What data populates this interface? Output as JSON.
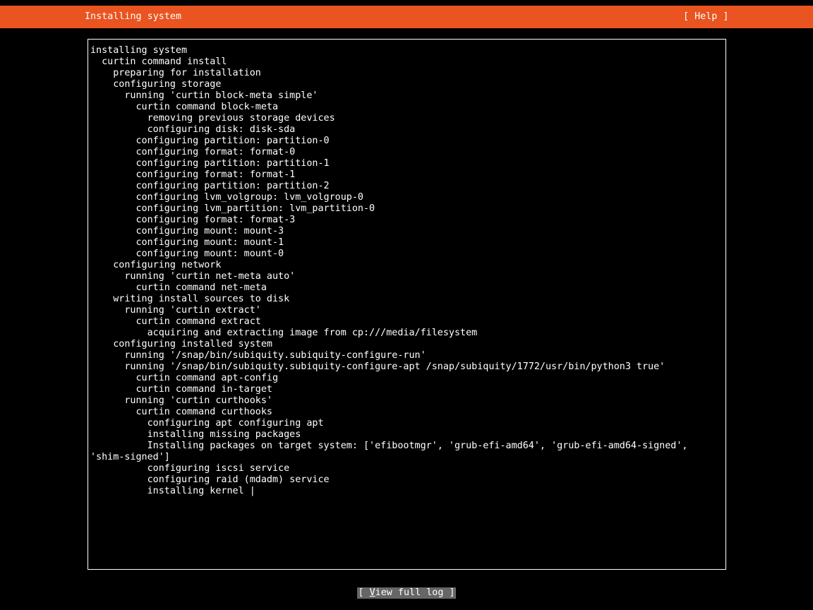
{
  "header": {
    "title": "Installing system",
    "help_label": "[ Help ]",
    "bar_color": "#e95420"
  },
  "log": {
    "lines": [
      "installing system",
      "  curtin command install",
      "    preparing for installation",
      "    configuring storage",
      "      running 'curtin block-meta simple'",
      "        curtin command block-meta",
      "          removing previous storage devices",
      "          configuring disk: disk-sda",
      "        configuring partition: partition-0",
      "        configuring format: format-0",
      "        configuring partition: partition-1",
      "        configuring format: format-1",
      "        configuring partition: partition-2",
      "        configuring lvm_volgroup: lvm_volgroup-0",
      "        configuring lvm_partition: lvm_partition-0",
      "        configuring format: format-3",
      "        configuring mount: mount-3",
      "        configuring mount: mount-1",
      "        configuring mount: mount-0",
      "    configuring network",
      "      running 'curtin net-meta auto'",
      "        curtin command net-meta",
      "    writing install sources to disk",
      "      running 'curtin extract'",
      "        curtin command extract",
      "          acquiring and extracting image from cp:///media/filesystem",
      "    configuring installed system",
      "      running '/snap/bin/subiquity.subiquity-configure-run'",
      "      running '/snap/bin/subiquity.subiquity-configure-apt /snap/subiquity/1772/usr/bin/python3 true'",
      "        curtin command apt-config",
      "        curtin command in-target",
      "      running 'curtin curthooks'",
      "        curtin command curthooks",
      "          configuring apt configuring apt",
      "          installing missing packages",
      "          Installing packages on target system: ['efibootmgr', 'grub-efi-amd64', 'grub-efi-amd64-signed',",
      "'shim-signed']",
      "          configuring iscsi service",
      "          configuring raid (mdadm) service",
      "          installing kernel "
    ],
    "spinner": "|"
  },
  "footer": {
    "open": "[ ",
    "accel": "V",
    "rest": "iew full log ]"
  }
}
